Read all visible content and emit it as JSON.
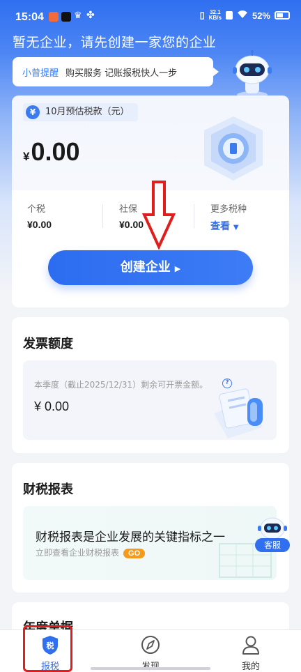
{
  "status_bar": {
    "time": "15:04",
    "speed": "32.1",
    "speed_unit": "KB/s",
    "battery": "52%"
  },
  "header": {
    "headline": "暂无企业，请先创建一家您的企业"
  },
  "tip": {
    "title": "小曾提醒",
    "text": "购买服务 记账报税快人一步"
  },
  "tax_estimate": {
    "label": "10月预估税款（元）",
    "currency": "¥",
    "amount": "0.00",
    "items": [
      {
        "label": "个税",
        "value": "¥0.00"
      },
      {
        "label": "社保",
        "value": "¥0.00"
      }
    ],
    "more_label": "更多税种",
    "more_link": "查看"
  },
  "create_button": {
    "label": "创建企业"
  },
  "invoice": {
    "title": "发票额度",
    "desc": "本季度（截止2025/12/31）剩余可开票金额。",
    "amount": "¥ 0.00"
  },
  "reports": {
    "title": "财税报表",
    "headline": "财税报表是企业发展的关键指标之一",
    "sub": "立即查看企业财税报表",
    "go": "GO"
  },
  "customer_service": {
    "label": "客服"
  },
  "next_section": {
    "title": "年度单据"
  },
  "tabs": [
    {
      "label": "报税",
      "icon": "tax-shield-icon",
      "active": true
    },
    {
      "label": "发现",
      "icon": "compass-icon",
      "active": false
    },
    {
      "label": "我的",
      "icon": "user-icon",
      "active": false
    }
  ],
  "colors": {
    "accent": "#2f6ff0",
    "annotation_red": "#e01e1e",
    "go_badge": "#f59a1b"
  }
}
